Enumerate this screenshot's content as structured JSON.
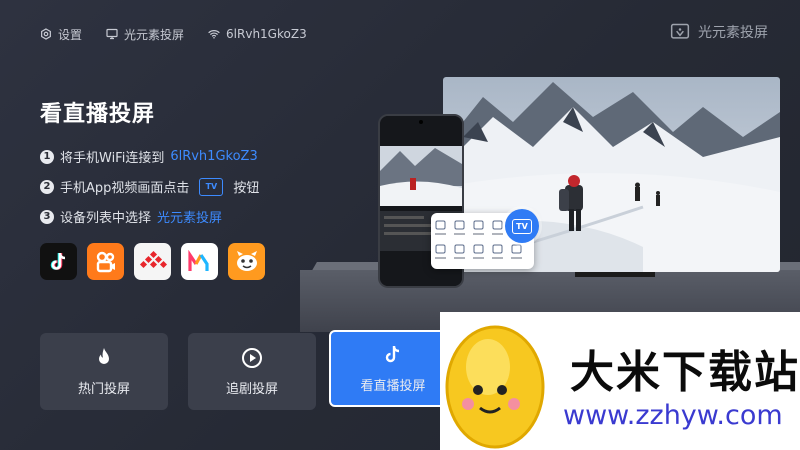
{
  "topbar": {
    "settings_label": "设置",
    "device_label": "光元素投屏",
    "wifi_label": "6lRvh1GkoZ3"
  },
  "brand": {
    "label": "光元素投屏",
    "icon": "cast-icon"
  },
  "main": {
    "title": "看直播投屏",
    "steps": [
      {
        "num": "1",
        "text": "将手机WiFi连接到",
        "highlight": "6lRvh1GkoZ3"
      },
      {
        "num": "2",
        "text": "手机App视频画面点击",
        "badge": "TV",
        "suffix": "按钮"
      },
      {
        "num": "3",
        "text": "设备列表中选择",
        "highlight": "光元素投屏"
      }
    ],
    "apps": [
      {
        "name": "douyin",
        "icon": "douyin-icon",
        "color": "#111111"
      },
      {
        "name": "kuaishou",
        "icon": "kuaishou-icon",
        "color": "#ff7a1a"
      },
      {
        "name": "xigua",
        "icon": "xigua-icon",
        "color": "#f33a3a"
      },
      {
        "name": "mango",
        "icon": "mango-icon",
        "color": "#ffffff"
      },
      {
        "name": "huya",
        "icon": "huya-icon",
        "color": "#ff9a1f"
      }
    ]
  },
  "buttons": [
    {
      "label": "热门投屏",
      "icon": "flame-icon"
    },
    {
      "label": "追剧投屏",
      "icon": "play-icon"
    },
    {
      "label": "看直播投屏",
      "icon": "tiktok-icon",
      "active": true
    }
  ],
  "illustration": {
    "tv_button_label": "TV"
  },
  "watermark": {
    "title": "大米下载站",
    "url": "www.zzhyw.com"
  },
  "colors": {
    "accent": "#2f7bf5",
    "highlight": "#3d8bff",
    "background": "#2a2e39"
  }
}
